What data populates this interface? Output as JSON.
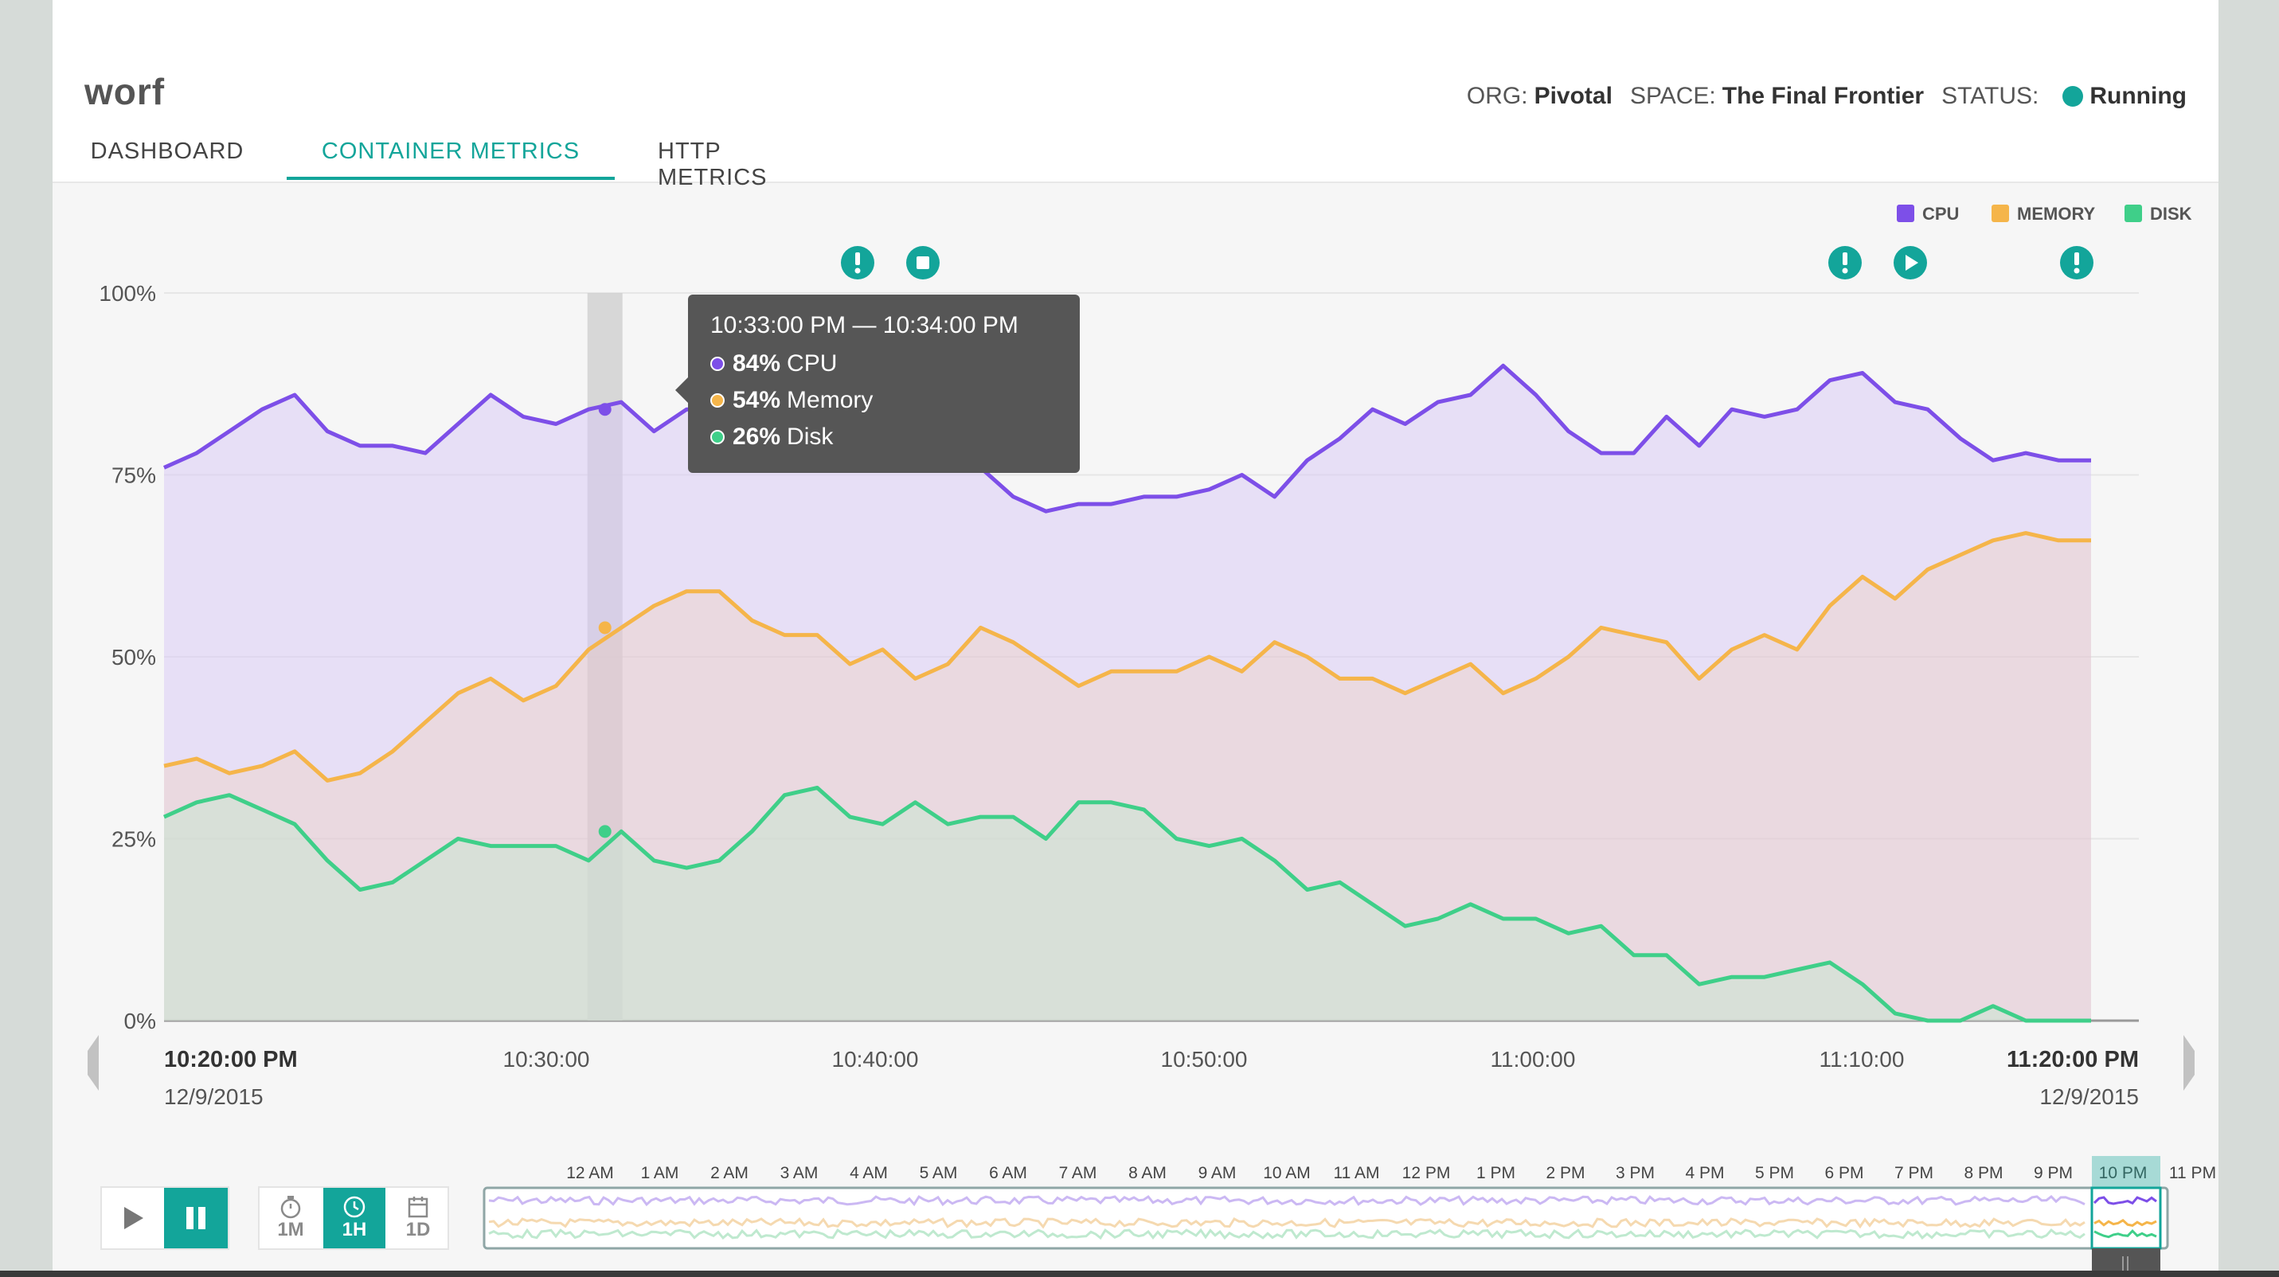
{
  "app": {
    "name": "worf",
    "org_label": "ORG:",
    "org": "Pivotal",
    "space_label": "SPACE:",
    "space": "The Final Frontier",
    "status_label": "STATUS:",
    "status": "Running",
    "status_color": "#13a59a"
  },
  "tabs": [
    {
      "label": "DASHBOARD"
    },
    {
      "label": "CONTAINER METRICS"
    },
    {
      "label": "HTTP METRICS"
    }
  ],
  "legend": [
    {
      "label": "CPU",
      "color": "#7d4fe8"
    },
    {
      "label": "MEMORY",
      "color": "#f5b54a"
    },
    {
      "label": "DISK",
      "color": "#3fcf89"
    }
  ],
  "events": [
    "alert-icon",
    "stop-icon",
    "alert-icon",
    "play-icon",
    "alert-icon"
  ],
  "tooltip": {
    "range": "10:33:00 PM — 10:34:00 PM",
    "rows": [
      {
        "value": "84%",
        "label": "CPU",
        "color": "#7d4fe8"
      },
      {
        "value": "54%",
        "label": "Memory",
        "color": "#f5b54a"
      },
      {
        "value": "26%",
        "label": "Disk",
        "color": "#3fcf89"
      }
    ]
  },
  "x_axis": {
    "start_time": "10:20:00 PM",
    "start_date": "12/9/2015",
    "end_time": "11:20:00 PM",
    "end_date": "12/9/2015",
    "ticks": [
      "10:30:00",
      "10:40:00",
      "10:50:00",
      "11:00:00",
      "11:10:00"
    ]
  },
  "timeline": {
    "hours": [
      "12 AM",
      "1 AM",
      "2 AM",
      "3 AM",
      "4 AM",
      "5 AM",
      "6 AM",
      "7 AM",
      "8 AM",
      "9 AM",
      "10 AM",
      "11 AM",
      "12 PM",
      "1 PM",
      "2 PM",
      "3 PM",
      "4 PM",
      "5 PM",
      "6 PM",
      "7 PM",
      "8 PM",
      "9 PM",
      "10 PM",
      "11 PM"
    ]
  },
  "controls": {
    "ranges": [
      {
        "label": "1M",
        "icon": "stopwatch-icon"
      },
      {
        "label": "1H",
        "icon": "clock-icon",
        "active": true
      },
      {
        "label": "1D",
        "icon": "calendar-icon"
      }
    ]
  },
  "chart_data": {
    "type": "area",
    "ylim": [
      0,
      100
    ],
    "y_ticks": [
      "100%",
      "75%",
      "50%",
      "25%",
      "0%"
    ],
    "x_minutes_from_start": [
      0,
      1,
      2,
      3,
      4,
      5,
      6,
      7,
      8,
      9,
      10,
      11,
      12,
      13,
      14,
      15,
      16,
      17,
      18,
      19,
      20,
      21,
      22,
      23,
      24,
      25,
      26,
      27,
      28,
      29,
      30,
      31,
      32,
      33,
      34,
      35,
      36,
      37,
      38,
      39,
      40,
      41,
      42,
      43,
      44,
      45,
      46,
      47,
      48,
      49,
      50,
      51,
      52,
      53,
      54,
      55,
      56,
      57,
      58,
      59
    ],
    "highlight_minute": 13.5,
    "series": [
      {
        "name": "CPU",
        "values": [
          76,
          78,
          81,
          84,
          86,
          81,
          79,
          79,
          78,
          82,
          86,
          83,
          82,
          84,
          85,
          81,
          84,
          84,
          80,
          78,
          80,
          80,
          80,
          79,
          81,
          76,
          72,
          70,
          71,
          71,
          72,
          72,
          73,
          75,
          72,
          77,
          80,
          84,
          82,
          85,
          86,
          90,
          86,
          81,
          78,
          78,
          83,
          79,
          84,
          83,
          84,
          88,
          89,
          85,
          84,
          80,
          77,
          78,
          77,
          77
        ]
      },
      {
        "name": "Memory",
        "values": [
          35,
          36,
          34,
          35,
          37,
          33,
          34,
          37,
          41,
          45,
          47,
          44,
          46,
          51,
          54,
          57,
          59,
          59,
          55,
          53,
          53,
          49,
          51,
          47,
          49,
          54,
          52,
          49,
          46,
          48,
          48,
          48,
          50,
          48,
          52,
          50,
          47,
          47,
          45,
          47,
          49,
          45,
          47,
          50,
          54,
          53,
          52,
          47,
          51,
          53,
          51,
          57,
          61,
          58,
          62,
          64,
          66,
          67,
          66,
          66
        ]
      },
      {
        "name": "Disk",
        "values": [
          28,
          30,
          31,
          29,
          27,
          22,
          18,
          19,
          22,
          25,
          24,
          24,
          24,
          22,
          26,
          22,
          21,
          22,
          26,
          31,
          32,
          28,
          27,
          30,
          27,
          28,
          28,
          25,
          30,
          30,
          29,
          25,
          24,
          25,
          22,
          18,
          19,
          16,
          13,
          14,
          16,
          14,
          14,
          12,
          13,
          9,
          9,
          5,
          6,
          6,
          7,
          8,
          5,
          1,
          0,
          0,
          2,
          0,
          0,
          0
        ]
      }
    ]
  }
}
